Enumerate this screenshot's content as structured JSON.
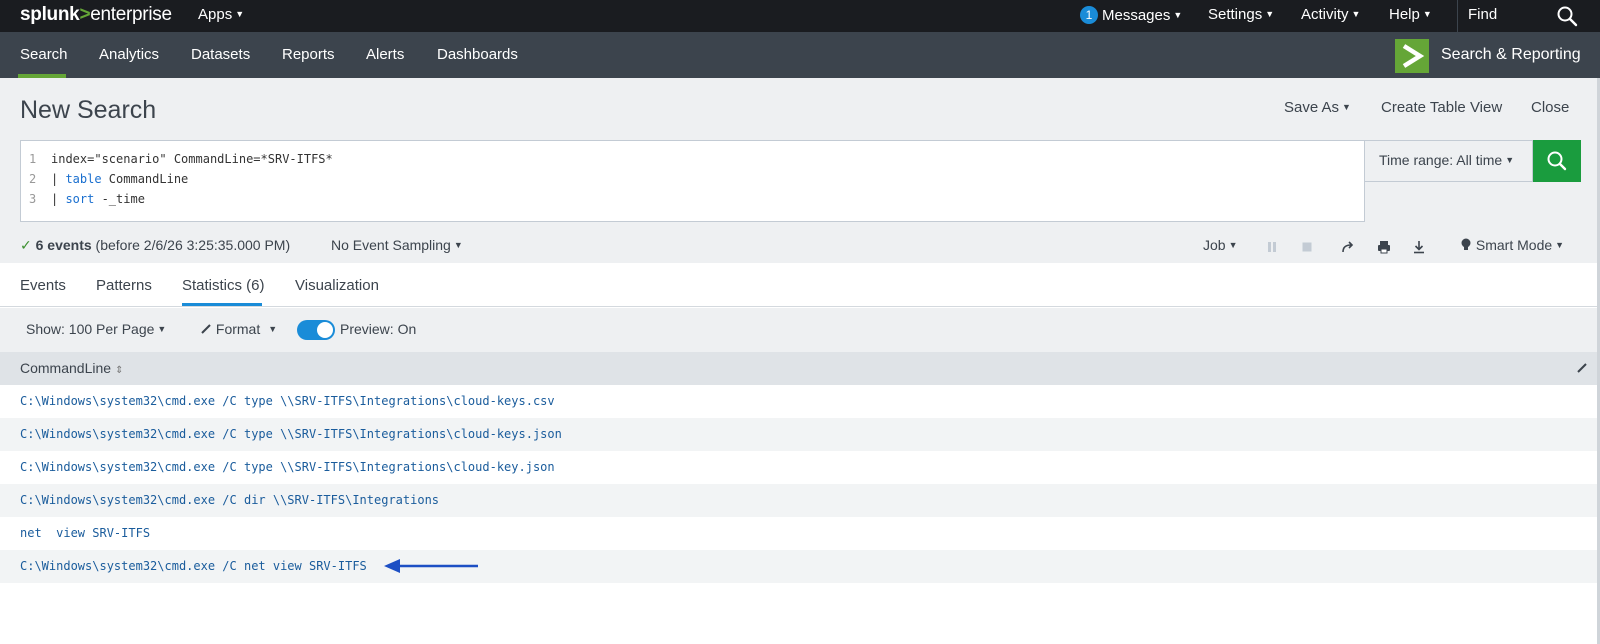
{
  "topbar": {
    "logo_splunk": "splunk",
    "logo_gt": ">",
    "logo_product": "enterprise",
    "apps_label": "Apps",
    "messages_count": "1",
    "messages_label": "Messages",
    "settings_label": "Settings",
    "activity_label": "Activity",
    "help_label": "Help",
    "find_label": "Find"
  },
  "appnav": {
    "items": [
      "Search",
      "Analytics",
      "Datasets",
      "Reports",
      "Alerts",
      "Dashboards"
    ],
    "active": "Search",
    "app_title": "Search & Reporting"
  },
  "header": {
    "title": "New Search",
    "save_as": "Save As",
    "create_table_view": "Create Table View",
    "close": "Close"
  },
  "query": {
    "line_numbers": [
      "1",
      "2",
      "3"
    ],
    "line1": "index=\"scenario\" CommandLine=*SRV-ITFS*",
    "line2_pipe": "| ",
    "line2_kw": "table",
    "line2_rest": " CommandLine",
    "line3_pipe": "| ",
    "line3_kw": "sort",
    "line3_rest": " -_time"
  },
  "time_range": "Time range: All time",
  "status": {
    "check": "✓",
    "events_bold": "6 events",
    "events_rest": " (before 2/6/26 3:25:35.000 PM)",
    "sampling": "No Event Sampling",
    "job": "Job",
    "smart_mode": "Smart Mode"
  },
  "tabs": {
    "events": "Events",
    "patterns": "Patterns",
    "statistics": "Statistics (6)",
    "visualization": "Visualization"
  },
  "toolbar": {
    "show": "Show: 100 Per Page",
    "format": "Format",
    "preview": "Preview: On"
  },
  "table": {
    "column": "CommandLine",
    "rows": [
      "C:\\Windows\\system32\\cmd.exe /C type \\\\SRV-ITFS\\Integrations\\cloud-keys.csv",
      "C:\\Windows\\system32\\cmd.exe /C type \\\\SRV-ITFS\\Integrations\\cloud-keys.json",
      "C:\\Windows\\system32\\cmd.exe /C type \\\\SRV-ITFS\\Integrations\\cloud-key.json",
      "C:\\Windows\\system32\\cmd.exe /C dir \\\\SRV-ITFS\\Integrations",
      "net  view SRV-ITFS",
      "C:\\Windows\\system32\\cmd.exe /C net view SRV-ITFS"
    ]
  },
  "colors": {
    "topbar_bg": "#1a1c20",
    "appbar_bg": "#3c444d",
    "accent_green": "#65a637",
    "search_button": "#1a9c3e",
    "link_blue": "#1a5c9c",
    "arrow_blue": "#1d4fc4"
  }
}
